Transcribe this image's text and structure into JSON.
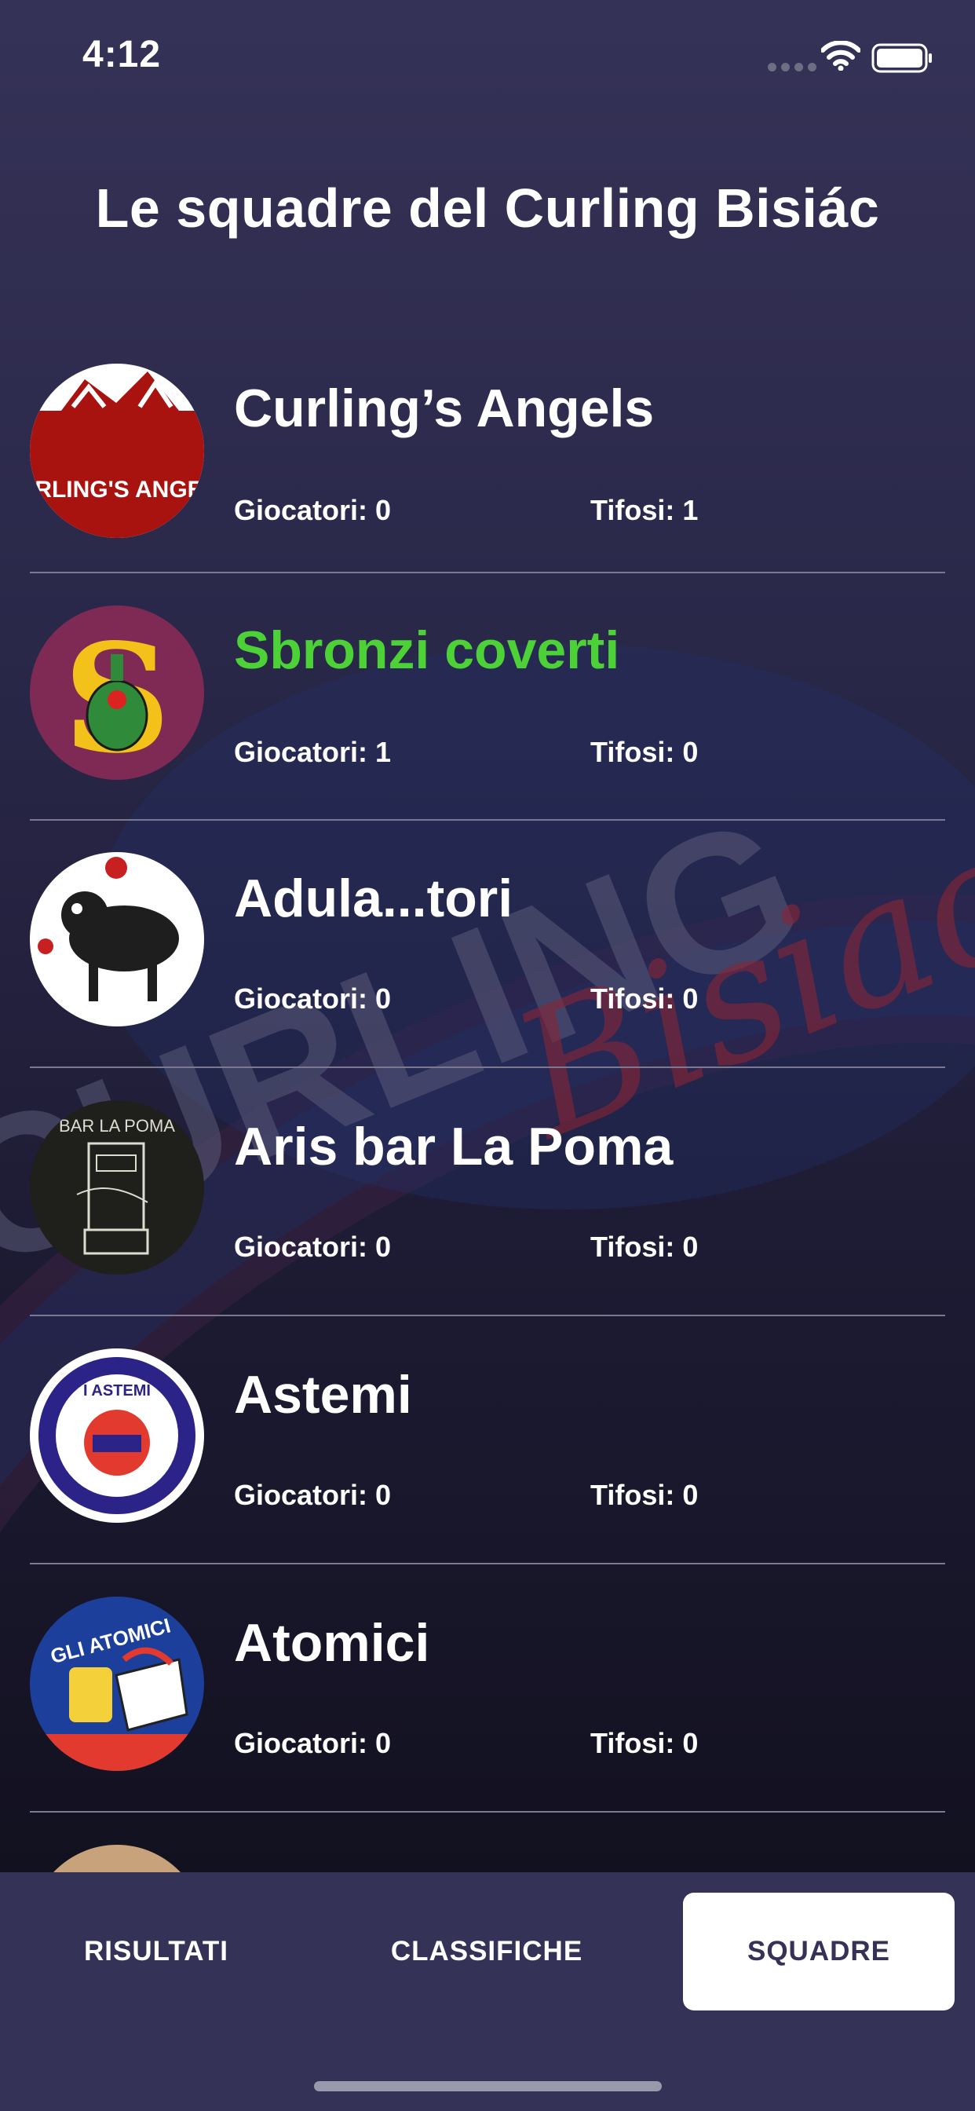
{
  "status_bar": {
    "time": "4:12"
  },
  "page": {
    "title": "Le squadre del Curling Bisiác"
  },
  "background": {
    "brand_word": "CURLING",
    "brand_script": "Bisiac"
  },
  "teams": [
    {
      "name": "Curling’s Angels",
      "players_label": "Giocatori: 0",
      "fans_label": "Tifosi: 1",
      "highlighted": false,
      "logo_text": "CURLING'S ANGELS"
    },
    {
      "name": "Sbronzi coverti",
      "players_label": "Giocatori: 1",
      "fans_label": "Tifosi: 0",
      "highlighted": true,
      "logo_text": "S"
    },
    {
      "name": "Adula...tori",
      "players_label": "Giocatori: 0",
      "fans_label": "Tifosi: 0",
      "highlighted": false,
      "logo_text": ""
    },
    {
      "name": "Aris bar La Poma",
      "players_label": "Giocatori: 0",
      "fans_label": "Tifosi: 0",
      "highlighted": false,
      "logo_text": "BAR LA POMA"
    },
    {
      "name": "Astemi",
      "players_label": "Giocatori: 0",
      "fans_label": "Tifosi: 0",
      "highlighted": false,
      "logo_text": "I ASTEMI"
    },
    {
      "name": "Atomici",
      "players_label": "Giocatori: 0",
      "fans_label": "Tifosi: 0",
      "highlighted": false,
      "logo_text": "GLI ATOMICI"
    }
  ],
  "tabs": [
    {
      "label": "RISULTATI",
      "active": false
    },
    {
      "label": "CLASSIFICHE",
      "active": false
    },
    {
      "label": "SQUADRE",
      "active": true
    }
  ],
  "colors": {
    "background": "#2a2849",
    "tab_bar": "#353257",
    "highlight": "#4cd137",
    "divider": "#7a7990"
  }
}
